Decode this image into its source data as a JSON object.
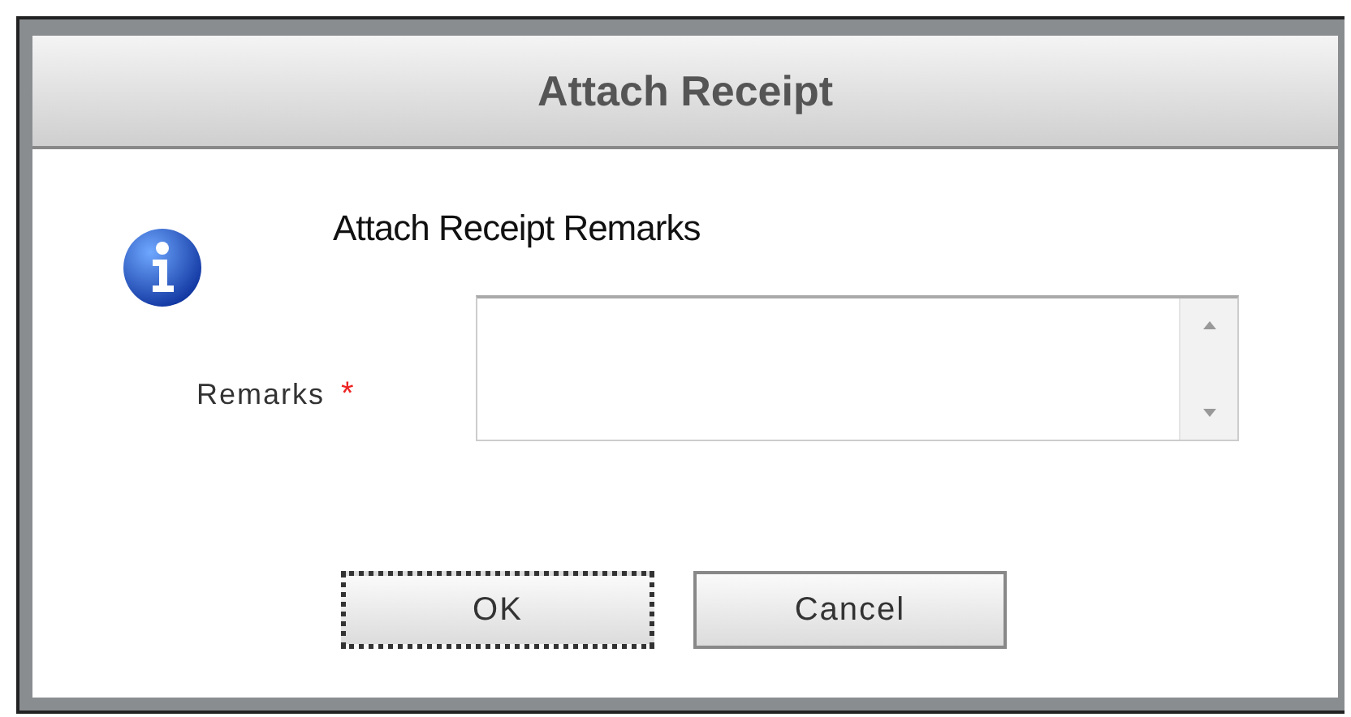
{
  "dialog": {
    "title": "Attach Receipt",
    "heading": "Attach Receipt Remarks",
    "field": {
      "label": "Remarks",
      "required": true,
      "required_mark": "*"
    },
    "buttons": [
      {
        "label": "OK",
        "focused": true
      },
      {
        "label": "Cancel",
        "focused": false
      }
    ]
  }
}
